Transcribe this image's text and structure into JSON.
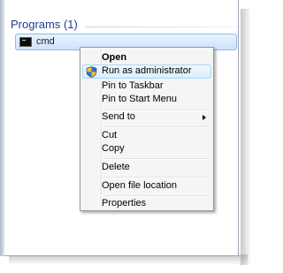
{
  "start_menu": {
    "section_title": "Programs (1)",
    "result": {
      "label": "cmd",
      "icon": "cmd-console-icon"
    }
  },
  "context_menu": {
    "items": [
      {
        "label": "Open",
        "bold": true
      },
      {
        "label": "Run as administrator",
        "icon": "uac-shield-icon",
        "hovered": true
      },
      {
        "label": "Pin to Taskbar"
      },
      {
        "label": "Pin to Start Menu"
      },
      {
        "label": "Send to",
        "submenu": true
      },
      {
        "label": "Cut"
      },
      {
        "label": "Copy"
      },
      {
        "label": "Delete"
      },
      {
        "label": "Open file location"
      },
      {
        "label": "Properties"
      }
    ]
  },
  "colors": {
    "section_title": "#1e3d8f",
    "selection_border": "#8fb8e8",
    "hover_border": "#a8d8f7",
    "menu_background": "#f5f5f5"
  }
}
